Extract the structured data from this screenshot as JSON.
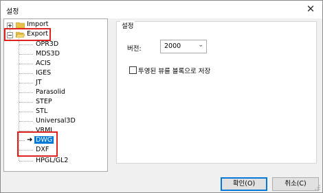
{
  "window": {
    "title": "설정"
  },
  "tree": {
    "import_label": "Import",
    "export_label": "Export",
    "children": [
      "OPR3D",
      "MDS3D",
      "ACIS",
      "IGES",
      "JT",
      "Parasolid",
      "STEP",
      "STL",
      "Universal3D",
      "VRML",
      "DWG",
      "DXF",
      "HPGL/GL2"
    ],
    "selected": "DWG"
  },
  "settings": {
    "group_title": "설정",
    "version_label": "버전:",
    "version_value": "2000",
    "transparent_label": "투영된 뷰를 블록으로 저장"
  },
  "buttons": {
    "ok": "확인(O)",
    "cancel": "취소(C)"
  },
  "colors": {
    "highlight": "#e0201c",
    "selection": "#0078d7",
    "folder": "#e8c14a"
  }
}
